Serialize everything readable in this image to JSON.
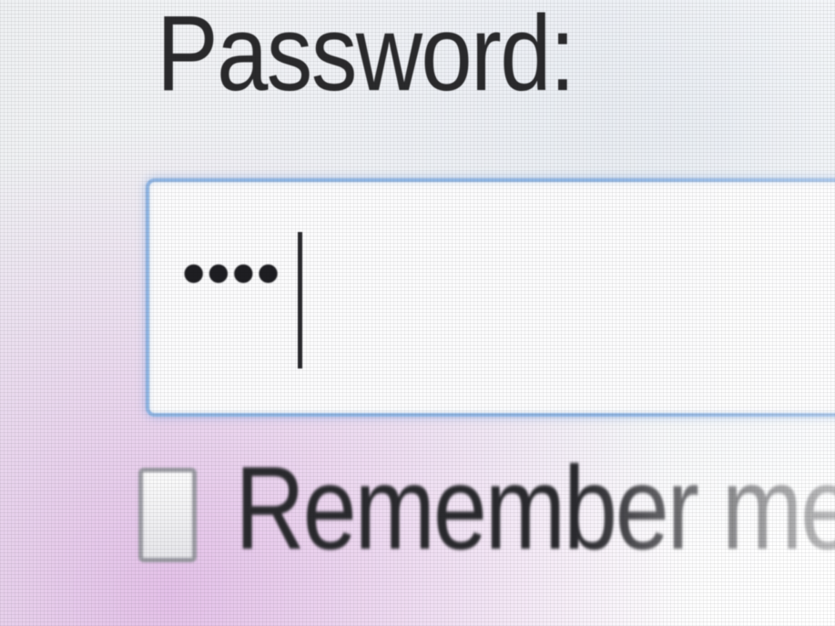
{
  "login_form": {
    "password_label": "Password:",
    "password_value": "••••",
    "remember_label": "Remember me",
    "remember_checked": false
  },
  "colors": {
    "field_border": "#8fb4e2",
    "text": "#2a2a2c",
    "checkbox_border": "#9a9aa2"
  }
}
